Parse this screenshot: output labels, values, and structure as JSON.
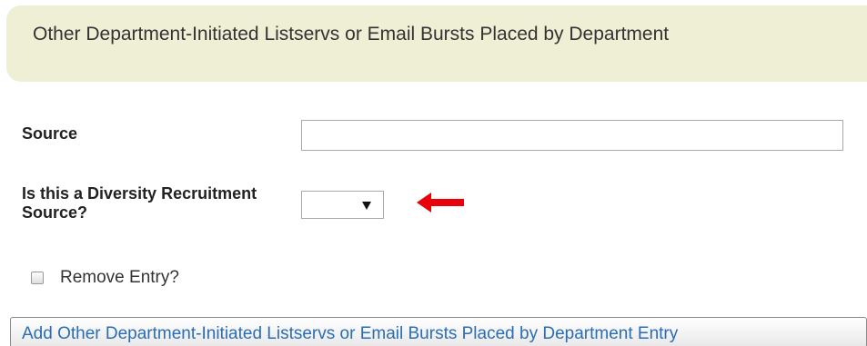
{
  "section": {
    "title": "Other Department-Initiated Listservs or Email Bursts Placed by Department"
  },
  "form": {
    "source_label": "Source",
    "source_value": "",
    "diversity_label": "Is this a Diversity Recruitment Source?",
    "diversity_selected": "",
    "remove_label": "Remove Entry?",
    "remove_checked": false
  },
  "actions": {
    "add_button_label": "Add Other Department-Initiated Listservs or Email Bursts Placed by Department Entry"
  },
  "annotation": {
    "arrow_icon": "left-arrow-icon",
    "arrow_color": "#e8000b"
  },
  "colors": {
    "header_bg": "#efefd6",
    "button_text": "#2a6db5"
  }
}
